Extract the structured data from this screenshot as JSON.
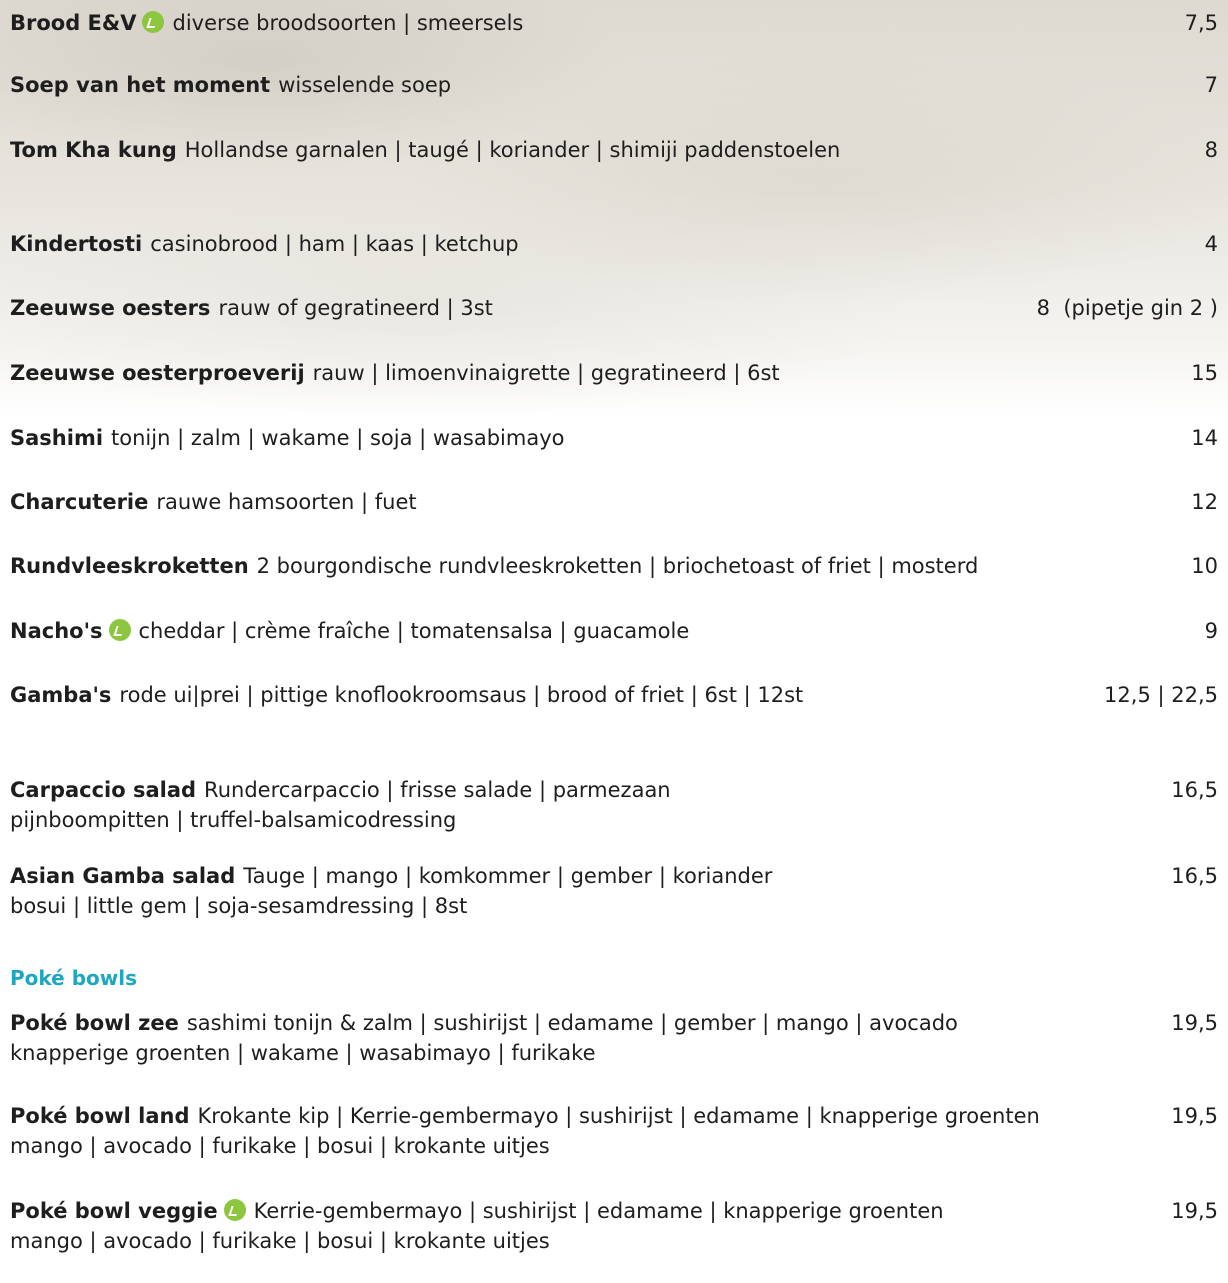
{
  "items": [
    {
      "name": "Brood E&V",
      "desc": "diverse broodsoorten | smeersels",
      "price": "7,5",
      "veg": true
    },
    {
      "name": "Soep van het moment",
      "desc": "wisselende soep",
      "price": "7"
    },
    {
      "name": "Tom Kha kung",
      "desc": "Hollandse garnalen | taugé | koriander | shimiji paddenstoelen",
      "price": "8"
    },
    {
      "name": "Kindertosti",
      "desc": "casinobrood | ham | kaas | ketchup",
      "price": "4"
    },
    {
      "name": "Zeeuwse oesters",
      "desc": "rauw of gegratineerd | 3st",
      "price": "8  (pipetje gin 2 )"
    },
    {
      "name": "Zeeuwse oesterproeverij",
      "desc": "rauw | limoenvinaigrette | gegratineerd | 6st",
      "price": "15"
    },
    {
      "name": "Sashimi",
      "desc": "tonijn | zalm | wakame | soja | wasabimayo",
      "price": "14"
    },
    {
      "name": "Charcuterie",
      "desc": "rauwe hamsoorten | fuet",
      "price": "12"
    },
    {
      "name": "Rundvleeskroketten",
      "desc": "2 bourgondische rundvleeskroketten | briochetoast of friet | mosterd",
      "price": "10"
    },
    {
      "name": "Nacho's",
      "desc": "cheddar | crème fraîche | tomatensalsa | guacamole",
      "price": "9",
      "veg": true
    },
    {
      "name": "Gamba's",
      "desc": "rode ui|prei | pittige knoflookroomsaus | brood of friet | 6st | 12st",
      "price": "12,5 | 22,5"
    },
    {
      "name": "Carpaccio salad",
      "desc": "Rundercarpaccio | frisse salade | parmezaan",
      "desc2": "pijnboompitten | truffel-balsamicodressing",
      "price": "16,5"
    },
    {
      "name": "Asian Gamba salad",
      "desc": "Tauge | mango | komkommer | gember | koriander",
      "desc2": "bosui | little gem | soja-sesamdressing | 8st",
      "price": "16,5"
    }
  ],
  "poke_section": {
    "title": "Poké bowls",
    "items": [
      {
        "name": "Poké bowl zee",
        "desc": "sashimi tonijn & zalm | sushirijst | edamame | gember | mango | avocado",
        "desc2": "knapperige groenten | wakame | wasabimayo | furikake",
        "price": "19,5"
      },
      {
        "name": "Poké bowl land",
        "desc": "Krokante kip | Kerrie-gembermayo | sushirijst | edamame | knapperige groenten",
        "desc2": "mango | avocado | furikake | bosui | krokante uitjes",
        "price": "19,5"
      },
      {
        "name": "Poké bowl veggie",
        "desc": "Kerrie-gembermayo | sushirijst | edamame | knapperige groenten",
        "desc2": "mango | avocado | furikake | bosui | krokante uitjes",
        "price": "19,5",
        "veg": true
      }
    ]
  },
  "icons": {
    "veg_icon": "vegetarian-leaf-icon",
    "veg_color": "#8cc63f",
    "section_color": "#1fa6c1"
  }
}
